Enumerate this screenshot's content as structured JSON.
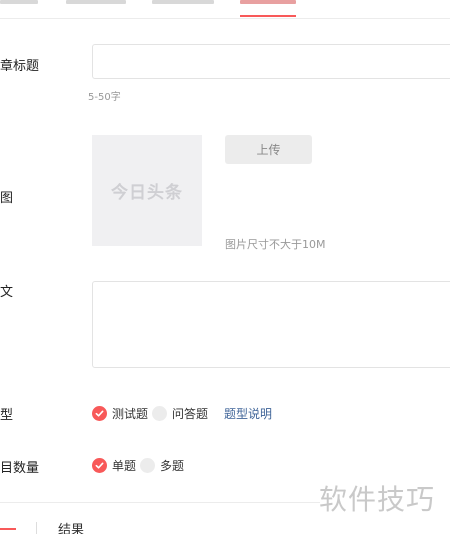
{
  "form": {
    "title_label": "章标题",
    "title_hint": "5-50字",
    "cover_label": "图",
    "cover_placeholder": "今日头条",
    "upload_label": "上传",
    "upload_hint": "图片尺寸不大于10M",
    "body_label": "文",
    "type_label": "型",
    "type_options": [
      "测试题",
      "问答题"
    ],
    "type_help_link": "题型说明",
    "count_label": "目数量",
    "count_options": [
      "单题",
      "多题"
    ]
  },
  "colors": {
    "accent": "#f85959",
    "link": "#406599"
  },
  "watermark": "软件技巧",
  "bottom_partial_text": "结果"
}
